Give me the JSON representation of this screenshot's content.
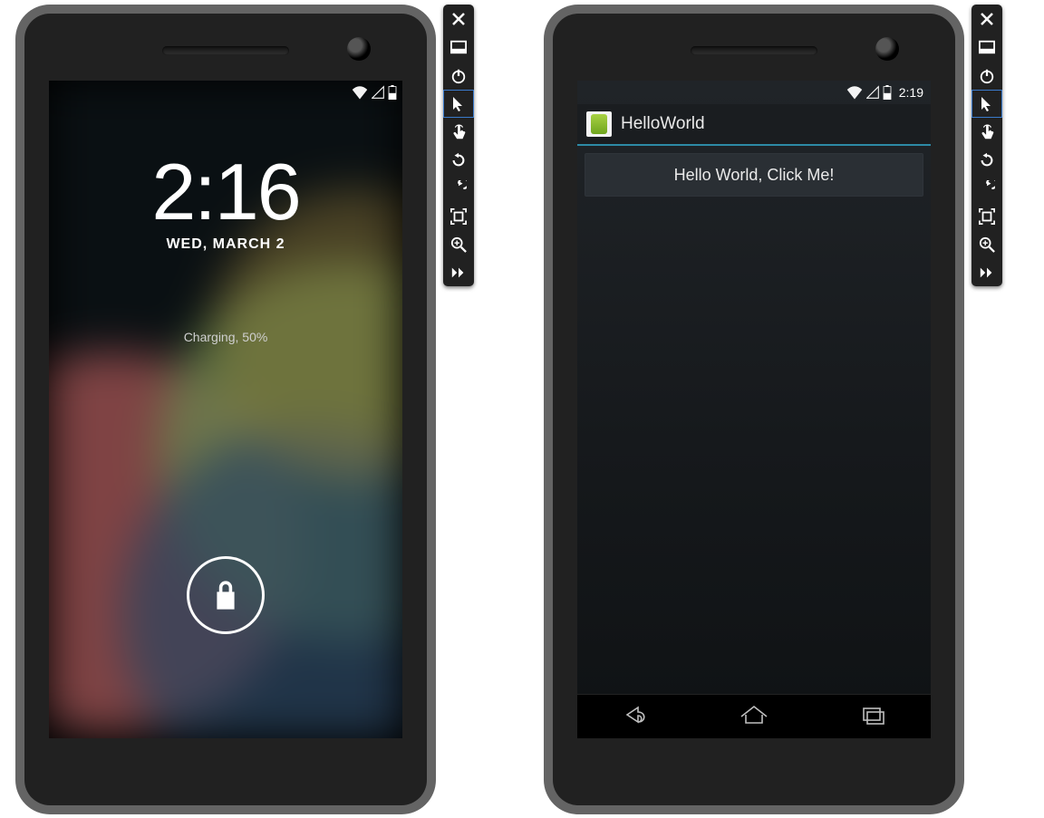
{
  "emulator1": {
    "statusbar": {
      "time": ""
    },
    "lockscreen": {
      "time": "2:16",
      "date": "WED, MARCH 2",
      "charging": "Charging, 50%",
      "unlock_icon": "lock-icon"
    },
    "toolbar": {
      "close": "close-icon",
      "window": "window-icon",
      "power": "power-icon",
      "pointer": "pointer-icon",
      "touch": "touch-icon",
      "rotate_ccw": "rotate-ccw-icon",
      "rotate_cw": "rotate-cw-icon",
      "frame": "frame-icon",
      "zoom": "zoom-icon",
      "more": "more-icon"
    }
  },
  "emulator2": {
    "statusbar": {
      "time": "2:19"
    },
    "app": {
      "title": "HelloWorld",
      "button_label": "Hello World, Click Me!"
    },
    "navbar": {
      "back": "back-icon",
      "home": "home-icon",
      "recent": "recent-apps-icon"
    },
    "toolbar": {
      "close": "close-icon",
      "window": "window-icon",
      "power": "power-icon",
      "pointer": "pointer-icon",
      "touch": "touch-icon",
      "rotate_ccw": "rotate-ccw-icon",
      "rotate_cw": "rotate-cw-icon",
      "frame": "frame-icon",
      "zoom": "zoom-icon",
      "more": "more-icon"
    }
  }
}
